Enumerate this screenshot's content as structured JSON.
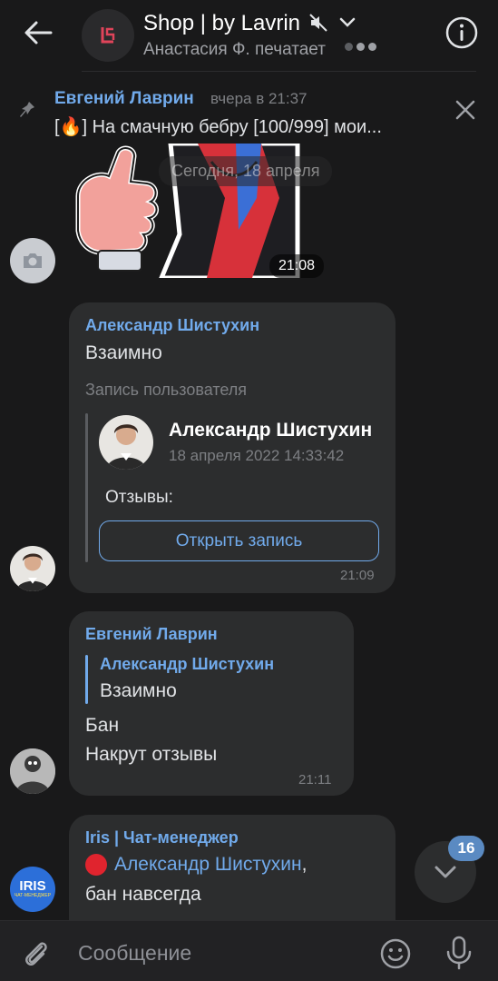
{
  "header": {
    "title": "Shop | by Lavrin",
    "subtitle": "Анастасия Ф. печатает",
    "icons": [
      "back-arrow-icon",
      "muted-icon",
      "chevron-down-icon",
      "info-icon"
    ]
  },
  "pinned": {
    "author": "Евгений Лаврин",
    "time": "вчера в 21:37",
    "text": "[🔥] На смачную бебру [100/999]  мои..."
  },
  "date_chip": "Сегодня, 18 апреля",
  "sticker": {
    "time": "21:08"
  },
  "messages": [
    {
      "author": "Александр Шистухин",
      "text": "Взаимно",
      "post": {
        "label": "Запись пользователя",
        "author": "Александр Шистухин",
        "date": "18 апреля 2022 14:33:42",
        "text": "Отзывы:",
        "button": "Открыть запись"
      },
      "time": "21:09"
    },
    {
      "author": "Евгений Лаврин",
      "reply": {
        "author": "Александр Шистухин",
        "text": "Взаимно"
      },
      "lines": [
        "Бан",
        "Накрут отзывы"
      ],
      "time": "21:11"
    },
    {
      "author": "Iris | Чат-менеджер",
      "mention": "Александр Шистухин",
      "mention_suffix": ",",
      "line2": "бан навсегда",
      "avatar_text": "IRIS",
      "avatar_subtext": "ЧАТ-МЕНЕДЖЕР"
    }
  ],
  "scroll": {
    "unread": "16"
  },
  "composer": {
    "placeholder": "Сообщение"
  },
  "colors": {
    "accent": "#71aaeb",
    "bubble": "#2c2d2e",
    "background": "#19191a"
  }
}
